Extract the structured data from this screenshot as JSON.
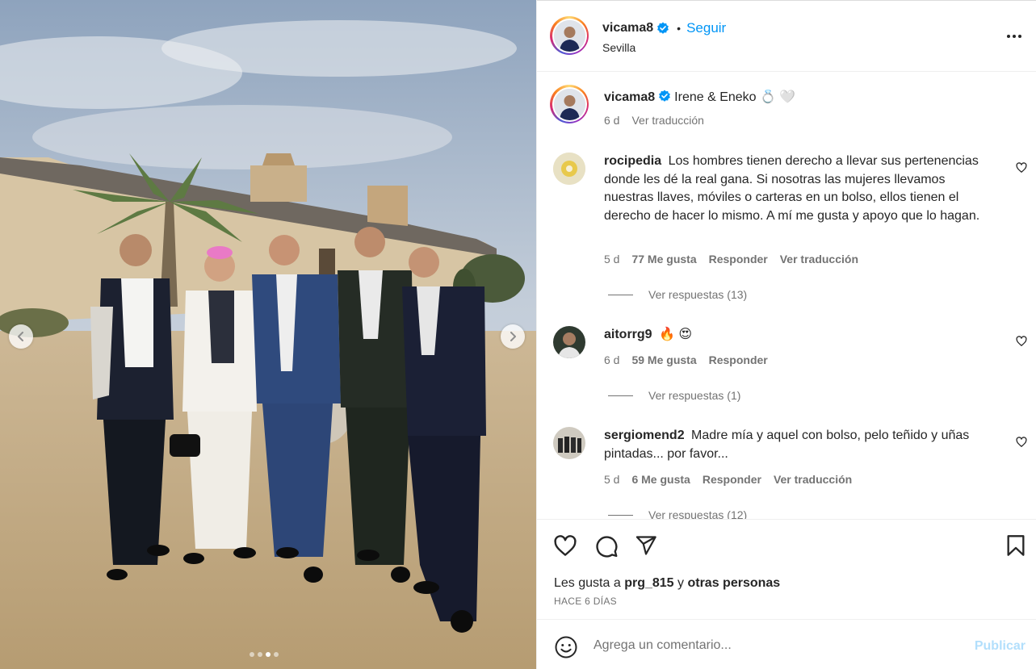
{
  "post": {
    "username": "vicama8",
    "follow_label": "Seguir",
    "separator": "•",
    "location": "Sevilla",
    "more_icon": "more-horizontal-icon",
    "verified_icon": "verified-badge-icon",
    "carousel": {
      "total": 4,
      "current": 3
    }
  },
  "caption": {
    "username": "vicama8",
    "text": "Irene & Eneko 💍 🤍",
    "time": "6 d",
    "translate": "Ver traducción"
  },
  "comments": [
    {
      "username": "rocipedia",
      "text": "Los hombres tienen derecho a llevar sus pertenencias donde les dé la real gana. Si nosotras las mujeres llevamos nuestras llaves, móviles o carteras en un bolso, ellos tienen el derecho de hacer lo mismo. A mí me gusta y apoyo que lo hagan.",
      "time": "5 d",
      "likes": "77 Me gusta",
      "reply": "Responder",
      "translate": "Ver traducción",
      "replies": "Ver respuestas (13)"
    },
    {
      "username": "aitorrg9",
      "text": "🔥 😍",
      "time": "6 d",
      "likes": "59 Me gusta",
      "reply": "Responder",
      "replies": "Ver respuestas (1)"
    },
    {
      "username": "sergiomend2",
      "text": "Madre mía y aquel con bolso, pelo teñido y uñas pintadas... por favor...",
      "time": "5 d",
      "likes": "6 Me gusta",
      "reply": "Responder",
      "translate": "Ver traducción",
      "replies": "Ver respuestas (12)"
    }
  ],
  "likes": {
    "prefix": "Les gusta a",
    "user": "prg_815",
    "conj": "y",
    "others": "otras personas"
  },
  "date": "HACE 6 DÍAS",
  "comment_box": {
    "placeholder": "Agrega un comentario...",
    "publish": "Publicar"
  },
  "colors": {
    "accent": "#0095f6",
    "publish_disabled": "#b2dffc",
    "muted": "#737373"
  }
}
